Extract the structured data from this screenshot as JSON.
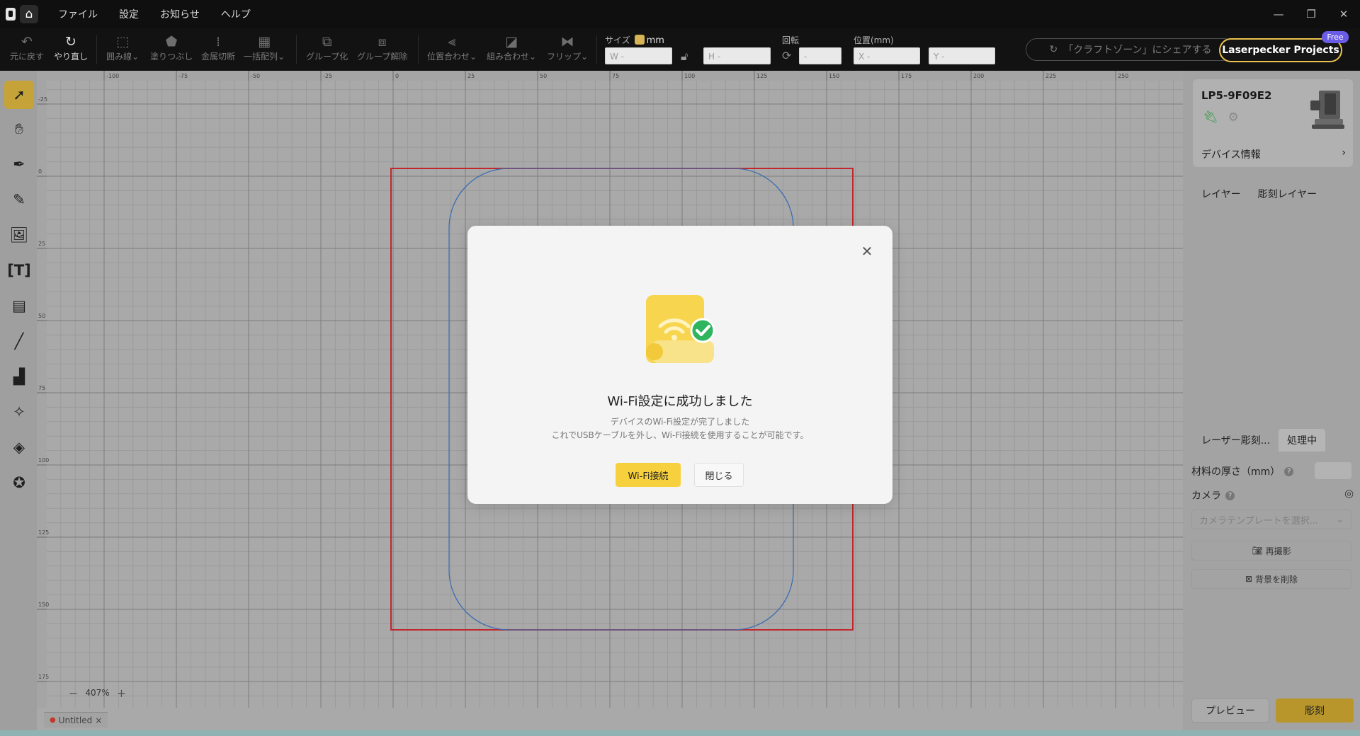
{
  "menu": [
    "ファイル",
    "設定",
    "お知らせ",
    "ヘルプ"
  ],
  "window_controls": [
    "—",
    "❐",
    "✕"
  ],
  "toolbar": {
    "undo": "元に戻す",
    "redo": "やり直し",
    "outline": "囲み線",
    "fill": "塗りつぶし",
    "metal_cut": "金属切断",
    "array": "一括配列",
    "group": "グループ化",
    "ungroup": "グループ解除",
    "align": "位置合わせ",
    "combine": "組み合わせ",
    "flip": "フリップ",
    "size_label": "サイズ",
    "unit": "mm",
    "w_placeholder": "W -",
    "h_placeholder": "H -",
    "rotate_label": "回転",
    "rotate_placeholder": "-",
    "position_label": "位置(mm)",
    "x_placeholder": "X -",
    "y_placeholder": "Y -",
    "share": "「クラフトゾーン」にシェアする",
    "projects": "Laserpecker Projects",
    "free_badge": "Free"
  },
  "canvas": {
    "zoom": "407%",
    "ruler_x": [
      "-100",
      "-75",
      "-50",
      "-25",
      "0",
      "25",
      "50",
      "75",
      "100",
      "125",
      "150",
      "175",
      "200",
      "225",
      "250"
    ],
    "ruler_y": [
      "-25",
      "0",
      "25",
      "50",
      "75",
      "100",
      "125",
      "150",
      "175"
    ],
    "doc_tab": "Untitled"
  },
  "device": {
    "name": "LP5-9F09E2",
    "info_link": "デバイス情報"
  },
  "right_panel": {
    "tab_layer": "レイヤー",
    "tab_engrave_layer": "彫刻レイヤー",
    "tab_laser": "レーザー彫刻...",
    "tab_processing": "処理中",
    "thickness_label": "材料の厚さ（mm）",
    "camera_label": "カメラ",
    "camera_placeholder": "カメラテンプレートを選択...",
    "retake": "再撮影",
    "remove_bg": "背景を削除",
    "preview": "プレビュー",
    "engrave": "彫刻"
  },
  "modal": {
    "title": "Wi-Fi設定に成功しました",
    "line1": "デバイスのWi-Fi設定が完了しました",
    "line2": "これでUSBケーブルを外し、Wi-Fi接続を使用することが可能です。",
    "primary_button": "Wi-Fi接続",
    "close_button": "閉じる"
  },
  "colors": {
    "accent_yellow": "#f7d13d",
    "work_area_red": "#c1272d",
    "shape_blue": "#3f6fb0",
    "success_green": "#2fb55d"
  }
}
